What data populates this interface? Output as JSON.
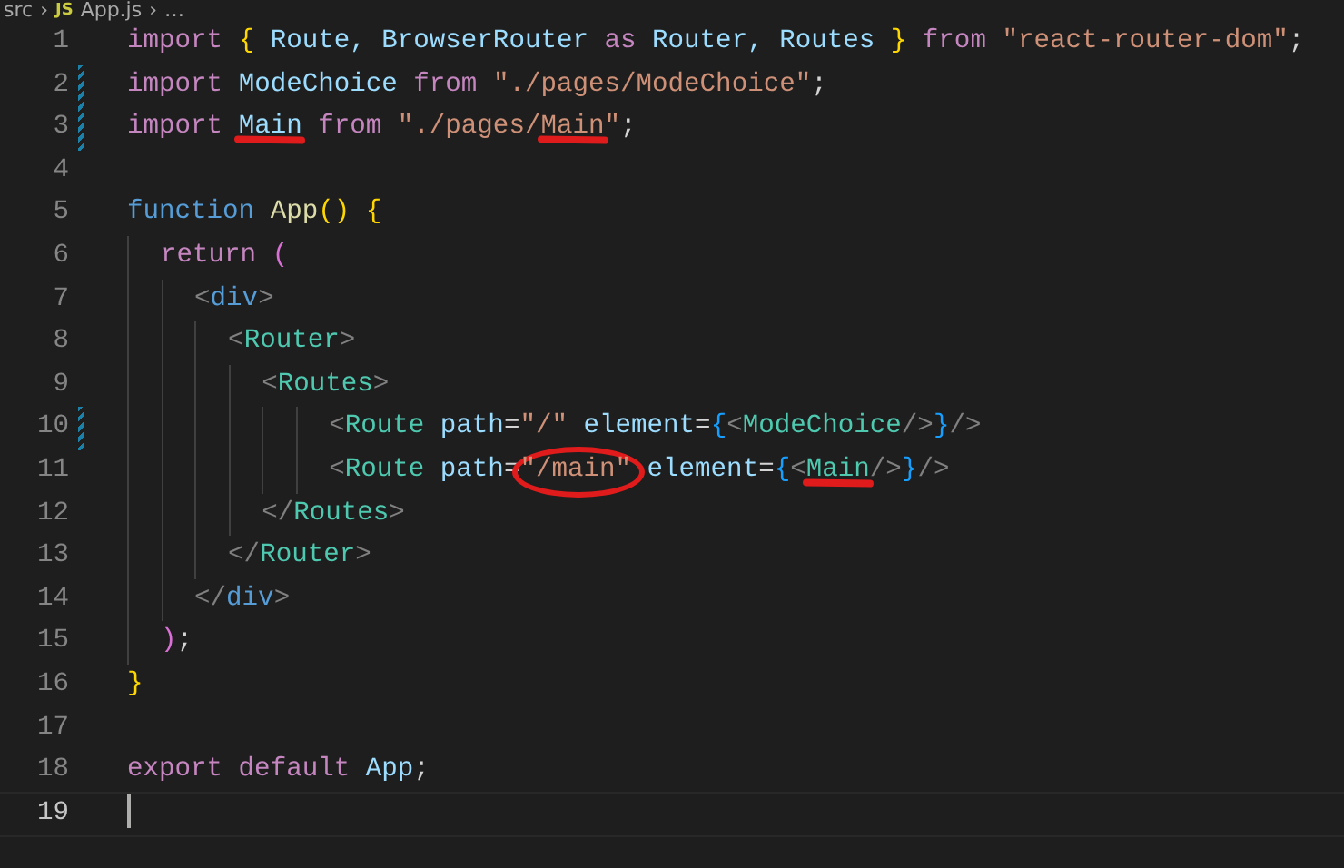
{
  "breadcrumb": {
    "items": [
      {
        "kind": "folder",
        "text": "src"
      },
      {
        "kind": "separator",
        "text": "›"
      },
      {
        "kind": "file",
        "icon": "JS",
        "text": "App.js"
      },
      {
        "kind": "separator",
        "text": "›"
      },
      {
        "kind": "more",
        "text": "…"
      }
    ]
  },
  "lines": [
    {
      "number": "1",
      "modified": false,
      "cursor": false,
      "tokens": [
        {
          "kind": "keyword",
          "text": "import "
        },
        {
          "kind": "brace",
          "text": "{ "
        },
        {
          "kind": "ident",
          "text": "Route, BrowserRouter "
        },
        {
          "kind": "keyword",
          "text": "as "
        },
        {
          "kind": "ident",
          "text": "Router, Routes "
        },
        {
          "kind": "brace",
          "text": "} "
        },
        {
          "kind": "keyword",
          "text": "from "
        },
        {
          "kind": "string",
          "text": "\"react-router-dom\""
        },
        {
          "kind": "plain",
          "text": ";"
        }
      ]
    },
    {
      "number": "2",
      "modified": true,
      "cursor": false,
      "tokens": [
        {
          "kind": "keyword",
          "text": "import "
        },
        {
          "kind": "ident",
          "text": "ModeChoice "
        },
        {
          "kind": "keyword",
          "text": "from "
        },
        {
          "kind": "string",
          "text": "\"./pages/ModeChoice\""
        },
        {
          "kind": "plain",
          "text": ";"
        }
      ]
    },
    {
      "number": "3",
      "modified": true,
      "cursor": false,
      "tokens": [
        {
          "kind": "keyword",
          "text": "import "
        },
        {
          "kind": "ident",
          "text": "Main",
          "underlined": true
        },
        {
          "kind": "keyword",
          "text": " from "
        },
        {
          "kind": "string",
          "text": "\"./pages/"
        },
        {
          "kind": "string",
          "text": "Main",
          "underlined": true
        },
        {
          "kind": "string",
          "text": "\""
        },
        {
          "kind": "plain",
          "text": ";"
        }
      ]
    },
    {
      "number": "4",
      "modified": false,
      "cursor": false
    },
    {
      "number": "5",
      "modified": false,
      "cursor": false,
      "tokens": [
        {
          "kind": "storage",
          "text": "function "
        },
        {
          "kind": "func",
          "text": "App"
        },
        {
          "kind": "brace",
          "text": "() {"
        }
      ]
    },
    {
      "number": "6",
      "modified": false,
      "cursor": false,
      "tokens": [
        {
          "kind": "keyword",
          "text": "  return "
        },
        {
          "kind": "paren",
          "text": "("
        }
      ]
    },
    {
      "number": "7",
      "modified": false,
      "cursor": false,
      "tokens": [
        {
          "kind": "angle",
          "text": "    <"
        },
        {
          "kind": "storage",
          "text": "div"
        },
        {
          "kind": "angle",
          "text": ">"
        }
      ]
    },
    {
      "number": "8",
      "modified": false,
      "cursor": false,
      "tokens": [
        {
          "kind": "angle",
          "text": "      <"
        },
        {
          "kind": "component",
          "text": "Router"
        },
        {
          "kind": "angle",
          "text": ">"
        }
      ]
    },
    {
      "number": "9",
      "modified": false,
      "cursor": false,
      "tokens": [
        {
          "kind": "angle",
          "text": "        <"
        },
        {
          "kind": "component",
          "text": "Routes"
        },
        {
          "kind": "angle",
          "text": ">"
        }
      ]
    },
    {
      "number": "10",
      "modified": true,
      "cursor": false,
      "tokens": [
        {
          "kind": "angle",
          "text": "            <"
        },
        {
          "kind": "component",
          "text": "Route "
        },
        {
          "kind": "ident",
          "text": "path"
        },
        {
          "kind": "plain",
          "text": "="
        },
        {
          "kind": "string",
          "text": "\"/\" "
        },
        {
          "kind": "ident",
          "text": "element"
        },
        {
          "kind": "plain",
          "text": "="
        },
        {
          "kind": "jsxbrace",
          "text": "{"
        },
        {
          "kind": "angle",
          "text": "<"
        },
        {
          "kind": "component",
          "text": "ModeChoice"
        },
        {
          "kind": "angle",
          "text": "/>"
        },
        {
          "kind": "jsxbrace",
          "text": "}"
        },
        {
          "kind": "angle",
          "text": "/>"
        }
      ]
    },
    {
      "number": "11",
      "modified": false,
      "cursor": false,
      "tokens": [
        {
          "kind": "angle",
          "text": "            <"
        },
        {
          "kind": "component",
          "text": "Route "
        },
        {
          "kind": "ident",
          "text": "path"
        },
        {
          "kind": "plain",
          "text": "="
        },
        {
          "kind": "string",
          "text": "\"/main\"",
          "circled": true
        },
        {
          "kind": "ident",
          "text": " element"
        },
        {
          "kind": "plain",
          "text": "="
        },
        {
          "kind": "jsxbrace",
          "text": "{"
        },
        {
          "kind": "angle",
          "text": "<"
        },
        {
          "kind": "component",
          "text": "Main",
          "underlined": true
        },
        {
          "kind": "angle",
          "text": "/>"
        },
        {
          "kind": "jsxbrace",
          "text": "}"
        },
        {
          "kind": "angle",
          "text": "/>"
        }
      ]
    },
    {
      "number": "12",
      "modified": false,
      "cursor": false,
      "tokens": [
        {
          "kind": "angle",
          "text": "        </"
        },
        {
          "kind": "component",
          "text": "Routes"
        },
        {
          "kind": "angle",
          "text": ">"
        }
      ]
    },
    {
      "number": "13",
      "modified": false,
      "cursor": false,
      "tokens": [
        {
          "kind": "angle",
          "text": "      </"
        },
        {
          "kind": "component",
          "text": "Router"
        },
        {
          "kind": "angle",
          "text": ">"
        }
      ]
    },
    {
      "number": "14",
      "modified": false,
      "cursor": false,
      "tokens": [
        {
          "kind": "angle",
          "text": "    </"
        },
        {
          "kind": "storage",
          "text": "div"
        },
        {
          "kind": "angle",
          "text": ">"
        }
      ]
    },
    {
      "number": "15",
      "modified": false,
      "cursor": false,
      "tokens": [
        {
          "kind": "paren",
          "text": "  )"
        },
        {
          "kind": "plain",
          "text": ";"
        }
      ]
    },
    {
      "number": "16",
      "modified": false,
      "cursor": false,
      "tokens": [
        {
          "kind": "brace",
          "text": "}"
        }
      ]
    },
    {
      "number": "17",
      "modified": false,
      "cursor": false
    },
    {
      "number": "18",
      "modified": false,
      "cursor": false,
      "tokens": [
        {
          "kind": "keyword",
          "text": "export default "
        },
        {
          "kind": "ident",
          "text": "App"
        },
        {
          "kind": "plain",
          "text": ";"
        }
      ]
    },
    {
      "number": "19",
      "modified": false,
      "cursor": true
    }
  ]
}
